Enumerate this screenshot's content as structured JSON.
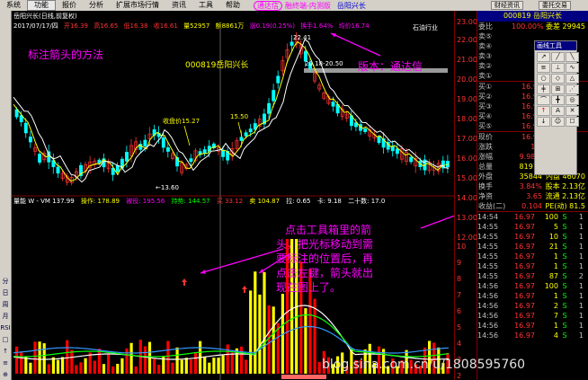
{
  "menu": {
    "items": [
      "系统",
      "功能",
      "报价",
      "分析",
      "扩展市场行情",
      "资讯",
      "工具",
      "帮助"
    ],
    "active_index": 1,
    "app_name": "通达信",
    "extra_link": "融终端-内测版",
    "stock_link": "岳阳兴长",
    "right_buttons": [
      "财经资讯",
      "委托交易"
    ]
  },
  "left_toolbar": [
    "分",
    "日",
    "周",
    "月",
    "RSI",
    "□",
    "↑",
    "≡",
    "⊕",
    "△"
  ],
  "chart": {
    "window_title": "岳阳兴长(日线,前复权)",
    "info_line": [
      "2017/07/17/四",
      "开16.39",
      "高16.65",
      "低16.38",
      "收16.61",
      "量52957",
      "额8861万",
      "涨0.19(0.25%)",
      "换手1.64%",
      "均价16.74"
    ],
    "overlay_labels": {
      "price_label": "收盘价15.27",
      "price_label2": "15.50",
      "low_label": "←13.60",
      "high_label": "22.41",
      "range_label": "20.18-20.50",
      "industry": "石油行业"
    },
    "vol_info": [
      "量能 W - VM 137.99",
      "操作: 178.89",
      "被役: 195.56",
      "持势: 144.57",
      "买 33.12",
      "卖 104.87",
      "拉: 0.65",
      "卡: 9.18",
      "二十数: 17.0"
    ]
  },
  "annotations": {
    "title": "标注箭头的方法",
    "stock": "000819岳阳兴长",
    "version": "版本：通达信",
    "inst_lines": [
      "点击工具箱里的箭",
      "头，把光标移动到需",
      "要标注的位置后，再",
      "点击左键，箭头就出",
      "现在图上了。"
    ]
  },
  "y_axis": {
    "ticks": [
      "23.00",
      "22.00",
      "21.00",
      "20.00",
      "19.00",
      "18.00",
      "17.00",
      "16.00",
      "15.00",
      "14.00",
      "13.00",
      "12.00",
      "10",
      "9",
      "8",
      "7",
      "6",
      "5",
      "4",
      "3",
      "2",
      "1"
    ]
  },
  "quote": {
    "header": "000819 岳阳兴长",
    "weibi": {
      "l": "委比",
      "v": "100.00%",
      "w": "委差 29945"
    },
    "sells": [
      {
        "l": "卖⑤",
        "v": "",
        "w": ""
      },
      {
        "l": "卖④",
        "v": "",
        "w": ""
      },
      {
        "l": "卖③",
        "v": "",
        "w": ""
      },
      {
        "l": "卖②",
        "v": "",
        "w": ""
      },
      {
        "l": "卖①",
        "v": "",
        "w": ""
      }
    ],
    "buys": [
      {
        "l": "买①",
        "v": "16.97",
        "w": ""
      },
      {
        "l": "买②",
        "v": "16.96",
        "w": ""
      },
      {
        "l": "买③",
        "v": "16.95",
        "w": ""
      },
      {
        "l": "买④",
        "v": "16.94",
        "w": ""
      },
      {
        "l": "买⑤",
        "v": "16.93",
        "w": ""
      }
    ],
    "stats": [
      {
        "l": "现价",
        "v": "16.97",
        "w": ""
      },
      {
        "l": "涨跌",
        "v": "1.5",
        "w": ""
      },
      {
        "l": "涨幅",
        "v": "9.98%",
        "w": ""
      },
      {
        "l": "总量",
        "v": "81914",
        "w": ""
      },
      {
        "l": "外盘",
        "v": "35844",
        "w": "内盘 46070"
      },
      {
        "l": "换手",
        "v": "3.84%",
        "w": "股本 2.13亿"
      },
      {
        "l": "净资",
        "v": "3.65",
        "w": "流通 2.13亿"
      },
      {
        "l": "收益(二)",
        "v": "0.104",
        "w": "PE(动) 81.5"
      }
    ],
    "ticks": [
      {
        "t": "14:54",
        "p": "16.97",
        "n": "100",
        "s": "S",
        "m": "1"
      },
      {
        "t": "14:55",
        "p": "16.97",
        "n": "5",
        "s": "S",
        "m": "1"
      },
      {
        "t": "14:55",
        "p": "16.97",
        "n": "10",
        "s": "S",
        "m": "1"
      },
      {
        "t": "14:55",
        "p": "16.97",
        "n": "21",
        "s": "S",
        "m": "1"
      },
      {
        "t": "14:55",
        "p": "16.97",
        "n": "1",
        "s": "S",
        "m": "1"
      },
      {
        "t": "14:55",
        "p": "16.97",
        "n": "1",
        "s": "S",
        "m": "1"
      },
      {
        "t": "14:55",
        "p": "16.97",
        "n": "87",
        "s": "S",
        "m": "2"
      },
      {
        "t": "14:56",
        "p": "16.97",
        "n": "100",
        "s": "S",
        "m": "1"
      },
      {
        "t": "14:56",
        "p": "16.97",
        "n": "1",
        "s": "S",
        "m": "1"
      },
      {
        "t": "14:56",
        "p": "16.97",
        "n": "2",
        "s": "S",
        "m": "1"
      },
      {
        "t": "14:56",
        "p": "16.97",
        "n": "7",
        "s": "S",
        "m": "1"
      },
      {
        "t": "14:56",
        "p": "16.97",
        "n": "1",
        "s": "S",
        "m": "1"
      },
      {
        "t": "14:56",
        "p": "16.97",
        "n": "4",
        "s": "S",
        "m": "1"
      }
    ]
  },
  "draw_tools": {
    "title": "画线工具",
    "tools": [
      "↗",
      "╱",
      "╲",
      "≡",
      "⊥",
      "∿",
      "○",
      "◇",
      "△",
      "╪",
      "⊞",
      "⋰",
      "⌒",
      "╋",
      "◎",
      "↑",
      "A",
      "✕",
      "↓",
      "☺",
      "☐"
    ]
  },
  "watermark": "blog.sina.com.cn/u/1808595760",
  "colors": {
    "up": "#ff3333",
    "down": "#00ffff",
    "anno": "#ff00ff",
    "yellow": "#ffff00",
    "vol_line1": "#ffffff",
    "vol_line2": "#00ff00",
    "vol_line3": "#3399ff"
  }
}
